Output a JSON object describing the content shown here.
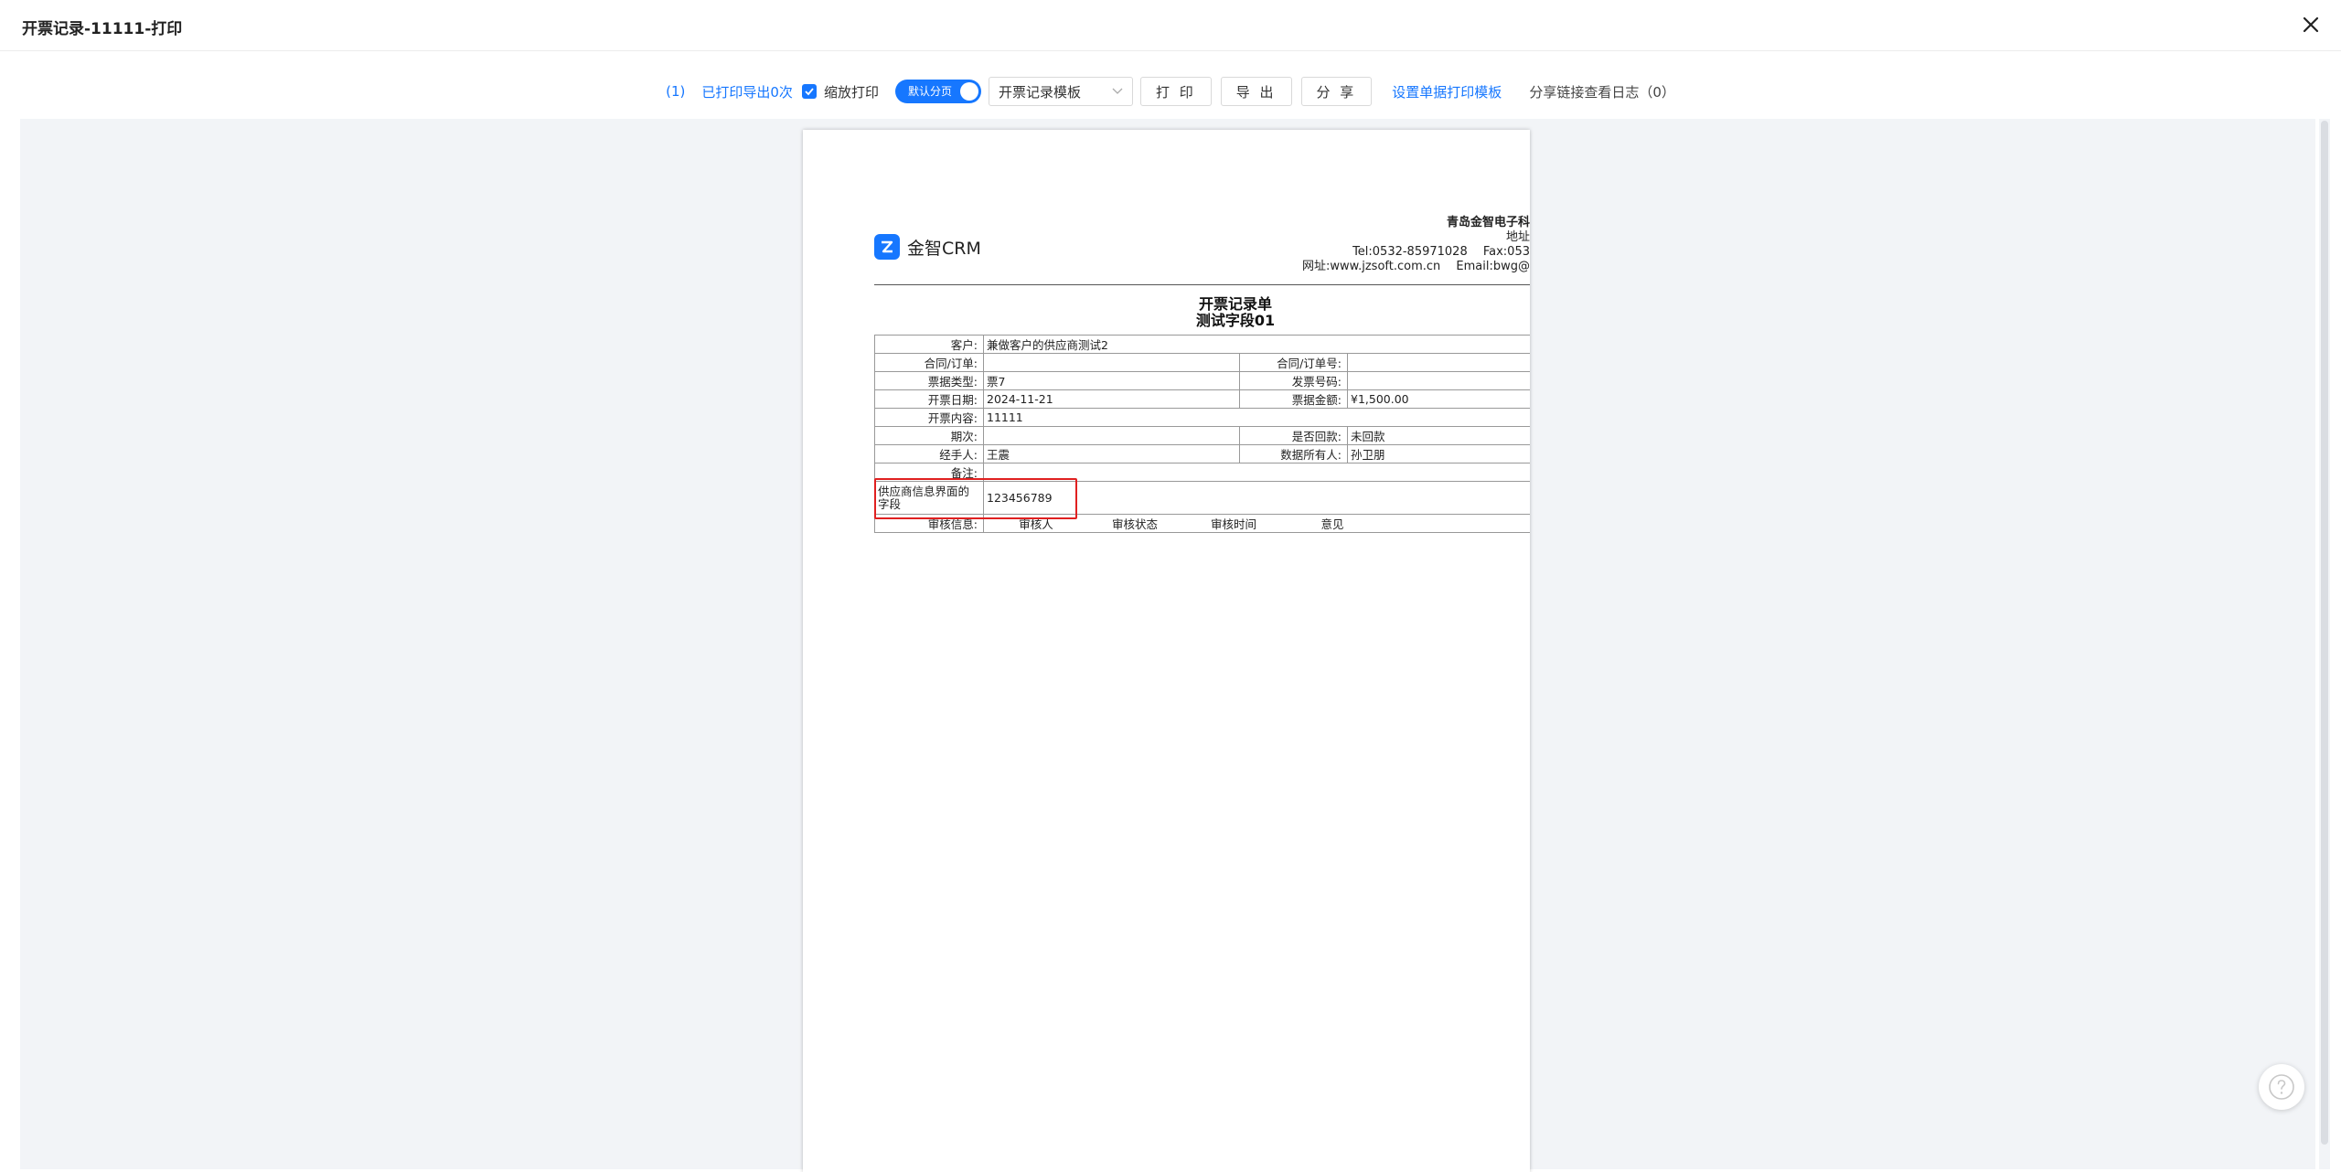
{
  "window": {
    "title": "开票记录-11111-打印"
  },
  "toolbar": {
    "print_count": "(1)",
    "print_export_link": "已打印导出0次",
    "zoom_print_label": "缩放打印",
    "zoom_print_checked": true,
    "paging_toggle_label": "默认分页",
    "template_select_value": "开票记录模板",
    "print_button": "打 印",
    "export_button": "导 出",
    "share_button": "分 享",
    "template_settings_link": "设置单据打印模板",
    "share_log_label": "分享链接查看日志（0）"
  },
  "document": {
    "logo_text": "金智CRM",
    "company": {
      "name": "青岛金智电子科",
      "address": "地址",
      "tel_fax": "Tel:0532-85971028　 Fax:053",
      "web_email": "网址:www.jzsoft.com.cn　 Email:bwg@"
    },
    "title": "开票记录单",
    "subtitle": "测试字段01",
    "rows": {
      "customer": {
        "label": "客户:",
        "value": "兼做客户的供应商测试2"
      },
      "contract": {
        "label": "合同/订单:",
        "value": "",
        "label2": "合同/订单号:",
        "value2": ""
      },
      "bill_type": {
        "label": "票据类型:",
        "value": "票7",
        "label2": "发票号码:",
        "value2": ""
      },
      "invoice_date": {
        "label": "开票日期:",
        "value": "2024-11-21",
        "label2": "票据金额:",
        "value2": "¥1,500.00"
      },
      "invoice_content": {
        "label": "开票内容:",
        "value": "11111"
      },
      "period": {
        "label": "期次:",
        "value": "",
        "label2": "是否回款:",
        "value2": "未回款"
      },
      "handler": {
        "label": "经手人:",
        "value": "王震",
        "label2": "数据所有人:",
        "value2": "孙卫朋"
      },
      "remark": {
        "label": "备注:",
        "value": ""
      },
      "supplier_field": {
        "label": "供应商信息界面的字段",
        "value": "123456789"
      },
      "audit": {
        "label": "审核信息:",
        "cols": [
          "审核人",
          "审核状态",
          "审核时间",
          "意见"
        ]
      }
    }
  },
  "colors": {
    "accent": "#1677ff",
    "highlight": "#e02020"
  }
}
